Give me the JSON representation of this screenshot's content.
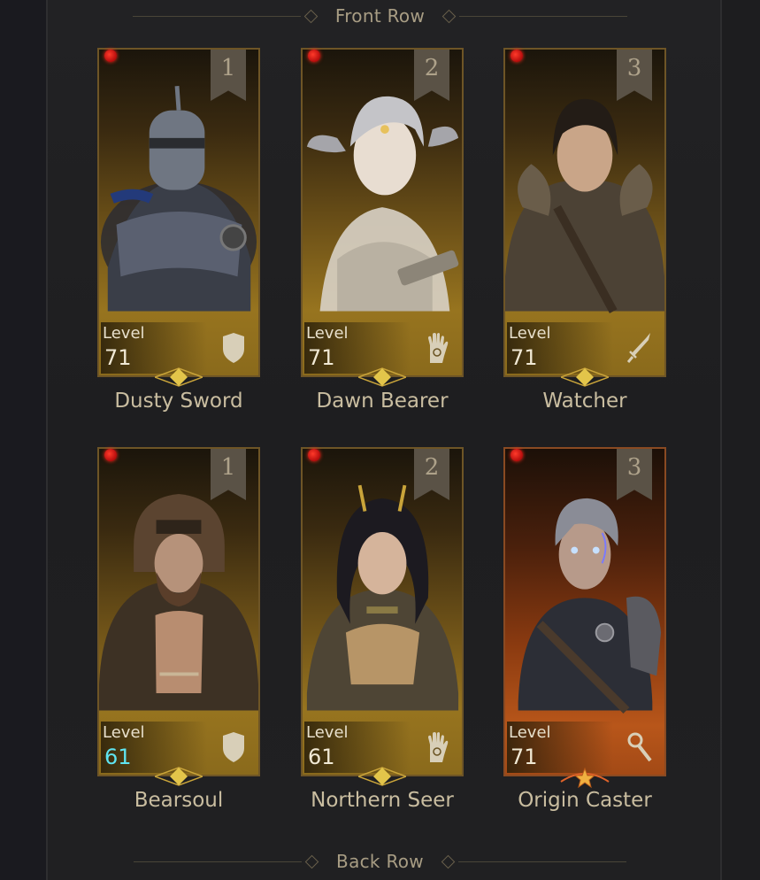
{
  "rows": {
    "front_label": "Front Row",
    "back_label": "Back Row"
  },
  "colors": {
    "accent_gold": "#c9a43a",
    "level_cyan": "#5fe4f0",
    "notification_red": "#d41a12"
  },
  "level_label": "Level",
  "front": [
    {
      "position": "1",
      "level": "71",
      "name": "Dusty Sword",
      "role_icon": "shield-icon"
    },
    {
      "position": "2",
      "level": "71",
      "name": "Dawn Bearer",
      "role_icon": "hand-spiral-icon"
    },
    {
      "position": "3",
      "level": "71",
      "name": "Watcher",
      "role_icon": "sword-icon"
    }
  ],
  "back": [
    {
      "position": "1",
      "level": "61",
      "name": "Bearsoul",
      "role_icon": "shield-icon"
    },
    {
      "position": "2",
      "level": "61",
      "name": "Northern Seer",
      "role_icon": "hand-spiral-icon"
    },
    {
      "position": "3",
      "level": "71",
      "name": "Origin Caster",
      "role_icon": "staff-icon"
    }
  ]
}
